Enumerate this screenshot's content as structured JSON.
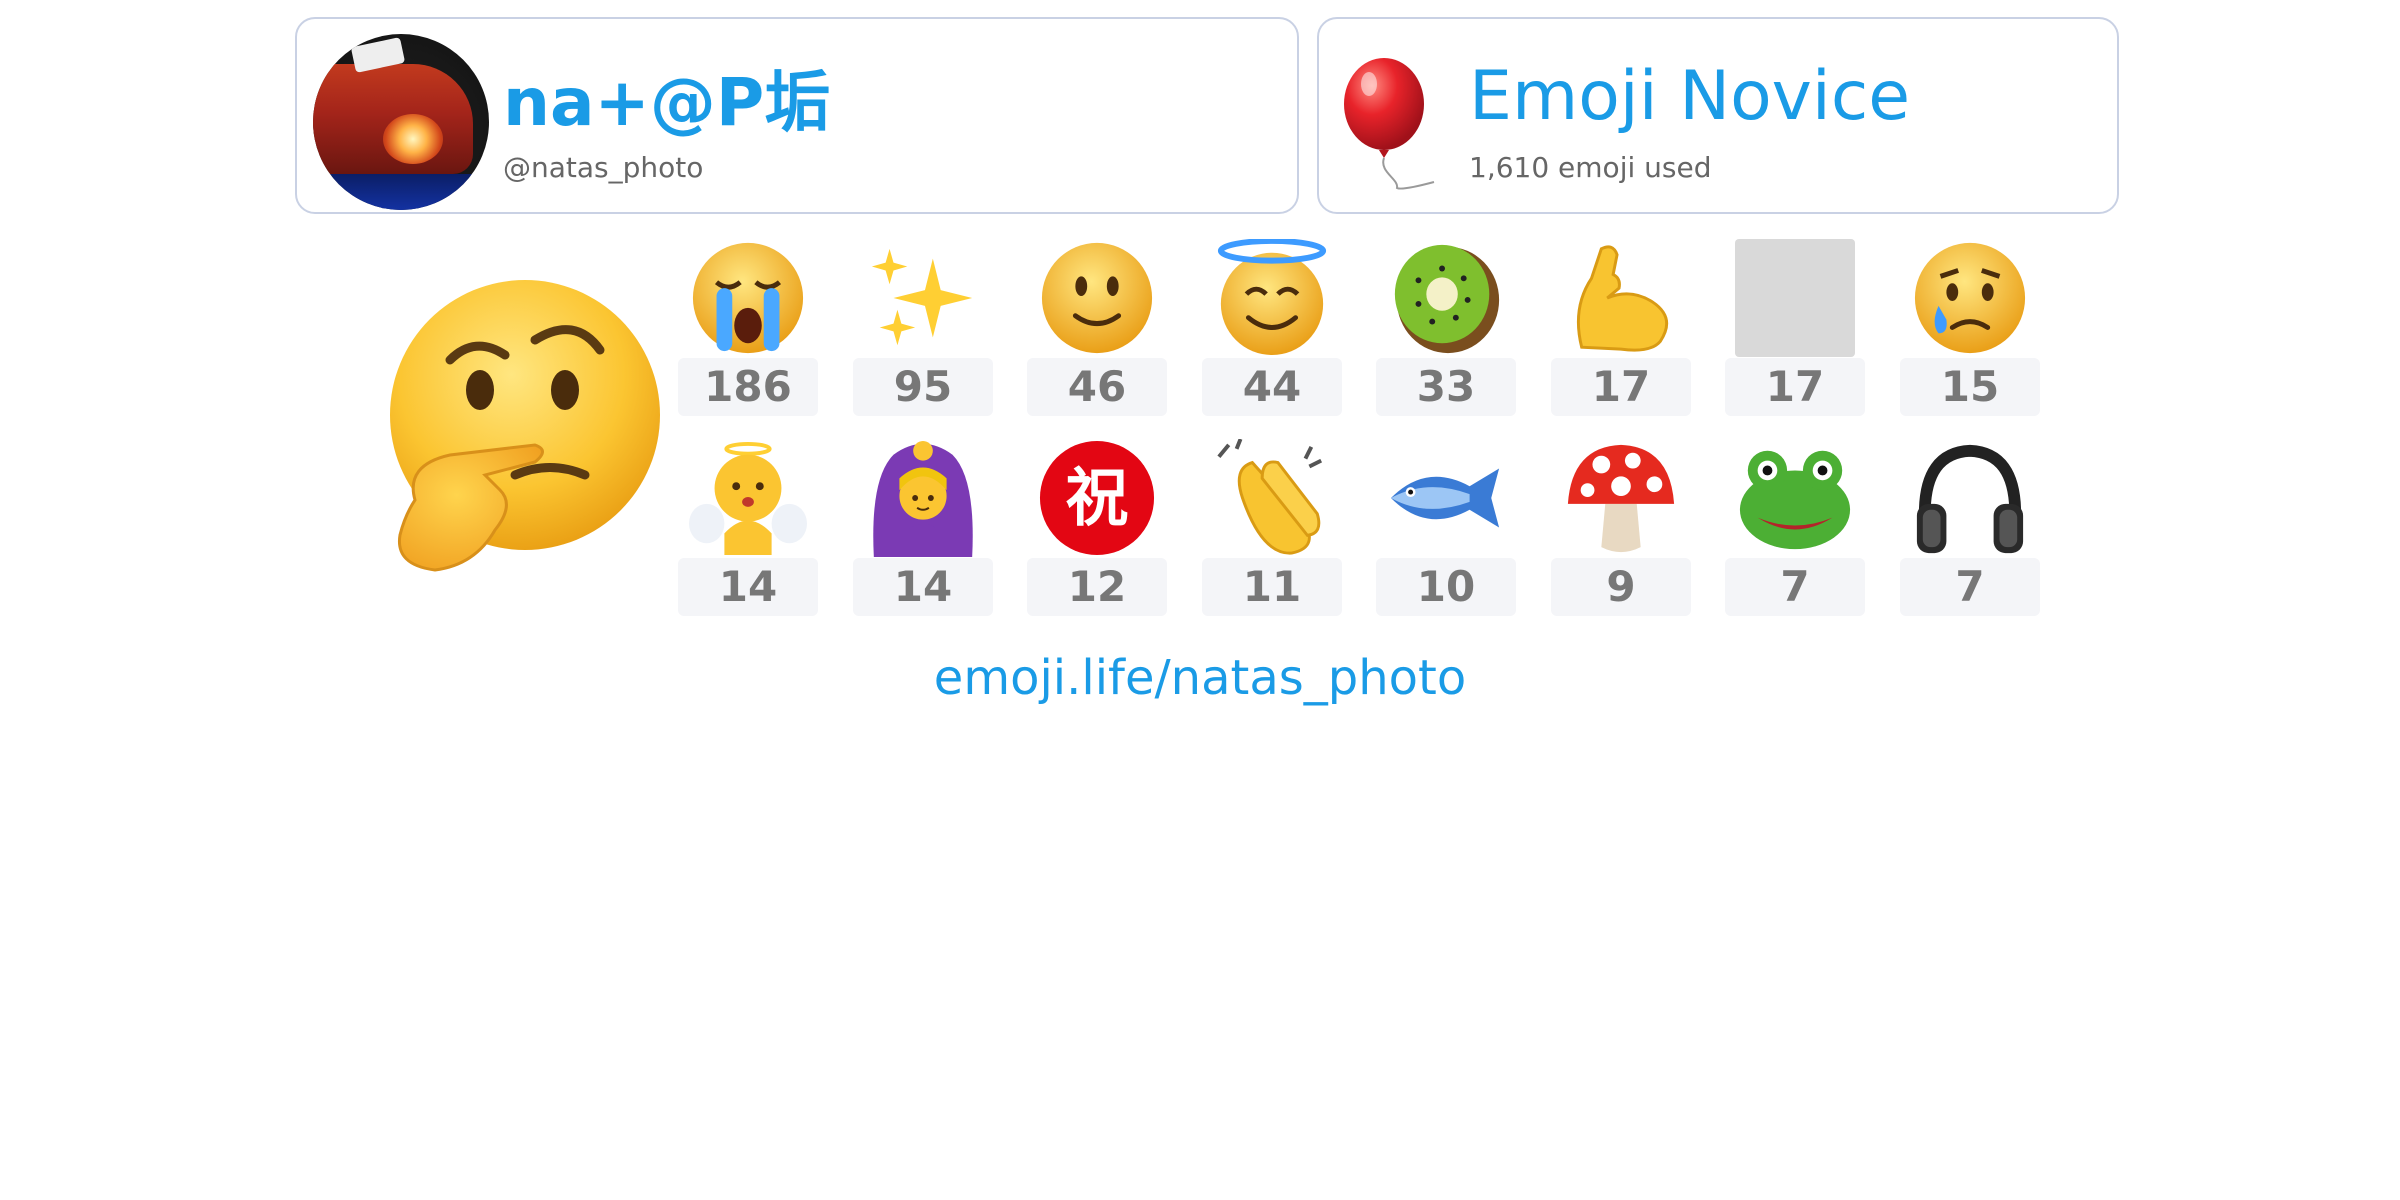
{
  "profile": {
    "name": "na+@P垢",
    "handle": "@natas_photo"
  },
  "level": {
    "title": "Emoji Novice",
    "subtitle": "1,610 emoji used",
    "icon": "balloon-icon"
  },
  "featured_emoji": "thinking-face-icon",
  "top_emoji": [
    {
      "icon": "loudly-crying-face-icon",
      "count": "186"
    },
    {
      "icon": "sparkles-icon",
      "count": "95"
    },
    {
      "icon": "slightly-smiling-face-icon",
      "count": "46"
    },
    {
      "icon": "smiling-face-with-halo-icon",
      "count": "44"
    },
    {
      "icon": "kiwi-fruit-icon",
      "count": "33"
    },
    {
      "icon": "flexed-biceps-icon",
      "count": "17"
    },
    {
      "icon": "missing-emoji-icon",
      "count": "17"
    },
    {
      "icon": "sad-but-relieved-face-icon",
      "count": "15"
    },
    {
      "icon": "baby-angel-icon",
      "count": "14"
    },
    {
      "icon": "woman-gesturing-ok-icon",
      "count": "14"
    },
    {
      "icon": "japanese-congratulations-button-icon",
      "count": "12"
    },
    {
      "icon": "clapping-hands-icon",
      "count": "11"
    },
    {
      "icon": "fish-icon",
      "count": "10"
    },
    {
      "icon": "mushroom-icon",
      "count": "9"
    },
    {
      "icon": "frog-icon",
      "count": "7"
    },
    {
      "icon": "headphone-icon",
      "count": "7"
    }
  ],
  "footer": {
    "link": "emoji.life/natas_photo"
  },
  "colors": {
    "accent": "#1a9be6",
    "card_border": "#c9d1e4",
    "count_bg": "#f4f5f8",
    "count_text": "#777777"
  }
}
